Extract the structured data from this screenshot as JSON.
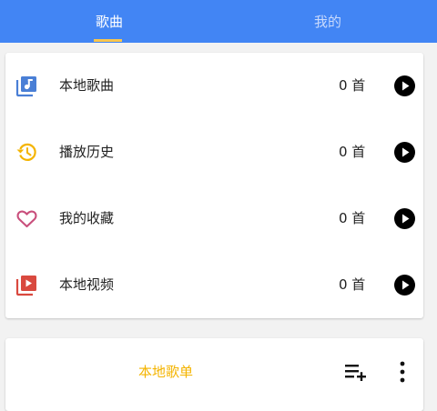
{
  "tabs": {
    "songs": "歌曲",
    "mine": "我的",
    "active": "songs"
  },
  "main_list": [
    {
      "label": "本地歌曲",
      "count": "0 首",
      "icon": "music-library-icon",
      "color": "#4a7fd6"
    },
    {
      "label": "播放历史",
      "count": "0 首",
      "icon": "history-icon",
      "color": "#f4b400"
    },
    {
      "label": "我的收藏",
      "count": "0 首",
      "icon": "heart-outline-icon",
      "color": "#c94f7c"
    },
    {
      "label": "本地视频",
      "count": "0 首",
      "icon": "video-library-icon",
      "color": "#d9493f"
    }
  ],
  "playlist": {
    "title": "本地歌单",
    "add_icon": "playlist-add-icon",
    "more_icon": "more-vertical-icon"
  },
  "colors": {
    "topbar": "#4285f4",
    "tab_indicator": "#f9c54c",
    "accent_yellow": "#f4b400"
  }
}
